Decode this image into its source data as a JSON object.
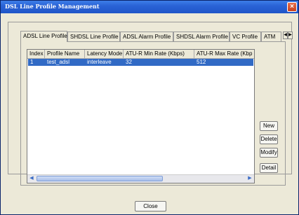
{
  "window": {
    "title": "DSL Line Profile Management",
    "close_glyph": "×"
  },
  "tabs": [
    {
      "label": "ADSL Line Profile",
      "active": true
    },
    {
      "label": "SHDSL Line Profile"
    },
    {
      "label": "ADSL Alarm Profile"
    },
    {
      "label": "SHDSL Alarm Profile"
    },
    {
      "label": "VC Profile"
    },
    {
      "label": "ATM"
    }
  ],
  "tab_arrows": {
    "left": "◀",
    "right": "▶"
  },
  "table": {
    "headers": [
      "Index",
      "Profile Name",
      "Latency Mode",
      "ATU-R Min Rate (Kbps)",
      "ATU-R Max Rate (Kbp"
    ],
    "rows": [
      [
        "1",
        "test_adsl",
        "interleave",
        "32",
        "512"
      ]
    ],
    "scroll_left": "◀",
    "scroll_right": "▶"
  },
  "buttons": {
    "new": "New",
    "delete": "Delete",
    "modify": "Modify",
    "detail": "Detail",
    "close": "Close"
  },
  "colors": {
    "title_bar": "#2a63d6",
    "selection": "#316ac5"
  }
}
